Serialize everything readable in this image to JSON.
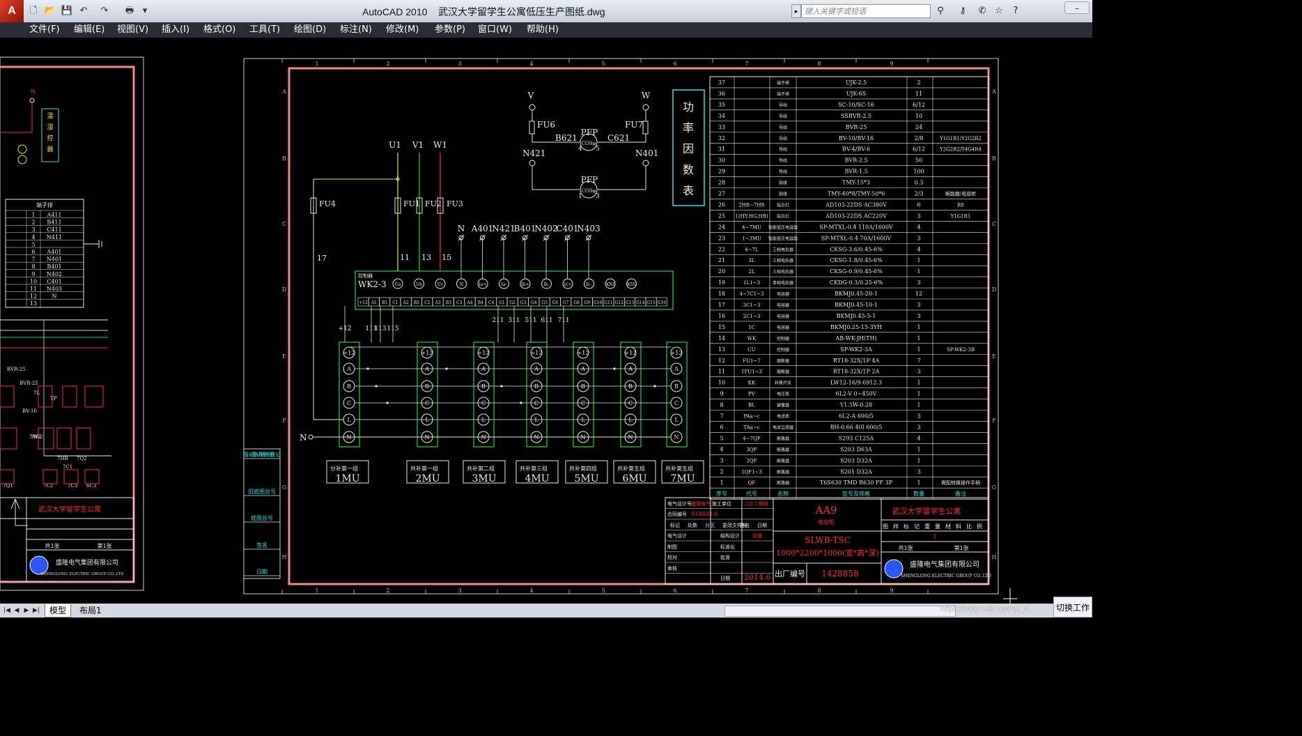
{
  "app": {
    "logo": "A",
    "title": "AutoCAD 2010",
    "file": "武汉大学留学生公寓低压生产图纸.dwg"
  },
  "quick_access": [
    {
      "name": "new-icon",
      "glyph": "🗋"
    },
    {
      "name": "open-icon",
      "glyph": "📂"
    },
    {
      "name": "save-icon",
      "glyph": "💾"
    },
    {
      "name": "undo-icon",
      "glyph": "↶"
    },
    {
      "name": "redo-icon",
      "glyph": "↷"
    },
    {
      "name": "plot-icon",
      "glyph": "🖶"
    },
    {
      "name": "dropdown-icon",
      "glyph": "▾"
    }
  ],
  "search": {
    "placeholder": "键入关键字或短语"
  },
  "title_icons": [
    {
      "name": "infocenter-icon",
      "glyph": "⚲"
    },
    {
      "name": "subscription-icon",
      "glyph": "⚷"
    },
    {
      "name": "communication-icon",
      "glyph": "✆"
    },
    {
      "name": "favorites-icon",
      "glyph": "☆"
    },
    {
      "name": "help-icon",
      "glyph": "?"
    }
  ],
  "window_controls": {
    "minimize": "–"
  },
  "menu": [
    "文件(F)",
    "编辑(E)",
    "视图(V)",
    "插入(I)",
    "格式(O)",
    "工具(T)",
    "绘图(D)",
    "标注(N)",
    "修改(M)",
    "参数(P)",
    "窗口(W)",
    "帮助(H)"
  ],
  "status": {
    "tabs": [
      "模型",
      "布局1"
    ],
    "active_tab": 0,
    "switch": "切换工作",
    "watermark": "https://blog.csdn.net/qq_4..."
  },
  "colors": {
    "frame": "#f08a8a",
    "green": "#1fd81f",
    "cyan": "#2fe0e0",
    "yellow": "#f0e040",
    "red": "#ff2a2a",
    "white": "#e8e8e8"
  },
  "drawing": {
    "grid_cols": [
      "1",
      "2",
      "3",
      "4",
      "5",
      "6",
      "7",
      "8",
      "9"
    ],
    "grid_rows": [
      "A",
      "B",
      "C",
      "D",
      "E",
      "F",
      "G",
      "H"
    ],
    "pfp1": {
      "v": "V",
      "w": "W",
      "fu6": "FU6",
      "fu7": "FU7",
      "b621": "B621",
      "c621": "C621",
      "label": "PFP",
      "cos": "COSφ",
      "n421": "N421",
      "n401": "N401",
      "p4": "4",
      "p5": "5"
    },
    "pfp2": {
      "label": "PFP",
      "cos": "COSφ",
      "p1": "1",
      "p3": "3"
    },
    "pf_title": [
      "功",
      "率",
      "因",
      "数",
      "表"
    ],
    "phase": {
      "u1": "U1",
      "v1": "V1",
      "w1": "W1",
      "fu1": "FU1",
      "fu2": "FU2",
      "fu3": "FU3",
      "fu4": "FU4",
      "n11": "11",
      "n13": "13",
      "n15": "15",
      "n17": "17"
    },
    "wk": {
      "header": "控制器",
      "name": "WK2-3",
      "top_terms": [
        "Ua",
        "Ub",
        "Uc",
        "N",
        "Ia+",
        "Ia-",
        "Ib+",
        "Ib-",
        "Ic+",
        "Ic-",
        "KNI",
        "KNI"
      ],
      "top_labels": [
        "N",
        "A401",
        "N421",
        "B401",
        "N402",
        "C401",
        "N403"
      ],
      "bottom_terms": [
        "+12",
        "A1",
        "B1",
        "C1",
        "A2",
        "B2",
        "C2",
        "A3",
        "B3",
        "C3",
        "A4",
        "B4",
        "C4",
        "G1",
        "G2",
        "G3",
        "G4",
        "G5",
        "G6",
        "G7",
        "G8",
        "G9",
        "G10",
        "G11",
        "G12",
        "G13",
        "G14",
        "G15",
        "G16"
      ],
      "wire_labels": [
        "+12",
        "111",
        "113",
        "115",
        "211",
        "311",
        "511",
        "611",
        "711"
      ]
    },
    "mods": [
      {
        "title": "分补第一组",
        "name": "1MU"
      },
      {
        "title": "共补第一组",
        "name": "2MU"
      },
      {
        "title": "共补第二组",
        "name": "3MU"
      },
      {
        "title": "共补第三组",
        "name": "4MU"
      },
      {
        "title": "共补第四组",
        "name": "5MU"
      },
      {
        "title": "共补第五组",
        "name": "6MU"
      },
      {
        "title": "共补第五组",
        "name": "7MU"
      }
    ],
    "mod_terms": [
      "+12",
      "A",
      "B",
      "C",
      "L",
      "N"
    ],
    "n_label": "N",
    "bom": {
      "headers": [
        "序号",
        "代号",
        "名称",
        "型号及规格",
        "数量",
        "备注"
      ],
      "rows": [
        [
          "37",
          "",
          "端子排",
          "UJK-2.5",
          "2",
          ""
        ],
        [
          "36",
          "",
          "端子排",
          "UJK-6S",
          "11",
          ""
        ],
        [
          "35",
          "",
          "导线",
          "SC-10/SC-16",
          "6/12",
          ""
        ],
        [
          "34",
          "",
          "导线",
          "SSBVR-2.5",
          "10",
          ""
        ],
        [
          "33",
          "",
          "导线",
          "BVR-25",
          "24",
          ""
        ],
        [
          "32",
          "",
          "导线",
          "BV-10/BV-16",
          "2/8",
          "Y1G1R1/Y2G2R2"
        ],
        [
          "31",
          "",
          "导线",
          "BV-4/BV-6",
          "6/12",
          "Y2G2R2/Y4G4R4"
        ],
        [
          "30",
          "",
          "导线",
          "BVR-2.5",
          "50",
          ""
        ],
        [
          "29",
          "",
          "导线",
          "BVR-1.5",
          "100",
          ""
        ],
        [
          "28",
          "",
          "铜排",
          "TMY-15*3",
          "0.3",
          ""
        ],
        [
          "27",
          "",
          "铜排",
          "TMY-40*8/TMY-50*6",
          "2/3",
          "断路器/电容柜"
        ],
        [
          "26",
          "2HR~7HR",
          "指示灯",
          "AD103-22DS AC380V",
          "6",
          "R8"
        ],
        [
          "25",
          "1(HY,HG,HR)",
          "指示灯",
          "AD103-22DS AC220V",
          "3",
          "Y1G1R1"
        ],
        [
          "24",
          "4~7MU",
          "智能低压电容器",
          "SP-MTXL-0.4 110A/1600V",
          "4",
          ""
        ],
        [
          "23",
          "1~3MU",
          "智能低压电容器",
          "SP-MTXL-0.4 70A/1600V",
          "3",
          ""
        ],
        [
          "22",
          "4~7L",
          "三相电抗器",
          "CKSG-3.6/0.45-6%",
          "4",
          ""
        ],
        [
          "21",
          "3L",
          "三相电抗器",
          "CKSG-1.8/0.45-6%",
          "1",
          ""
        ],
        [
          "20",
          "2L",
          "三相电抗器",
          "CKSG-0.9/0.45-6%",
          "1",
          ""
        ],
        [
          "19",
          "1L1~3",
          "单相电抗器",
          "CKDG-0.3/0.25-6%",
          "3",
          ""
        ],
        [
          "18",
          "4~7C1~3",
          "电容器",
          "BKMJ0.45-20-1",
          "12",
          ""
        ],
        [
          "17",
          "3C1~3",
          "电容器",
          "BKMJ0.45-10-1",
          "3",
          ""
        ],
        [
          "16",
          "2C1~3",
          "电容器",
          "BKMJ0.45-5-1",
          "3",
          ""
        ],
        [
          "15",
          "1C",
          "电容器",
          "BKMJ0.25-15-3YH",
          "1",
          ""
        ],
        [
          "14",
          "WK",
          "控制器",
          "AB-WK-JH(TH)",
          "1",
          ""
        ],
        [
          "13",
          "CU",
          "控制器",
          "SP-WK2-3A",
          "1",
          "SP-WK2-3B"
        ],
        [
          "12",
          "FU1~7",
          "熔断器",
          "RT18-32X/1P 4A",
          "7",
          ""
        ],
        [
          "11",
          "1FU1~3",
          "熔断器",
          "RT18-32X/1P 2A",
          "3",
          ""
        ],
        [
          "10",
          "KK",
          "转换开关",
          "LW12-16/9.6912.3",
          "1",
          ""
        ],
        [
          "9",
          "PV",
          "电压表",
          "6L2-V 0~450V",
          "1",
          ""
        ],
        [
          "8",
          "BL",
          "避雷器",
          "Y1.5W-0.28",
          "1",
          ""
        ],
        [
          "7",
          "PAa~c",
          "电流表",
          "6L2-A 600/5",
          "3",
          ""
        ],
        [
          "6",
          "TAa~c",
          "电流互感器",
          "BH-0.66 40I 600/5",
          "3",
          ""
        ],
        [
          "5",
          "4~7QF",
          "断路器",
          "S293 C125A",
          "4",
          ""
        ],
        [
          "4",
          "3QF",
          "断路器",
          "S203 D63A",
          "1",
          ""
        ],
        [
          "3",
          "2QF",
          "断路器",
          "S203 D32A",
          "1",
          ""
        ],
        [
          "2",
          "1QF1~3",
          "断路器",
          "S201 D32A",
          "3",
          ""
        ],
        [
          "1",
          "QF",
          "断路器",
          "T6S630 TMD R630 FF 3P",
          "1",
          "需配转换操作手柄"
        ]
      ]
    },
    "title_block": {
      "project": "武汉大学留学生公寓",
      "aa9": "AA9",
      "cabinet": "电容柜",
      "model": "SLWB-TSC",
      "dims": "1000*2200*1000(宽*高*深)",
      "factory_label": "出厂编号",
      "factory_no": "1428858",
      "date": "2014.6",
      "company_cn": "盛隆电气集团有限公司",
      "company_en": "SHENGLONG ELECTRIC GROUP CO.,LTD",
      "sheet_total": "共1张",
      "sheet_no": "第1张",
      "r1a": "电气设计号",
      "r1b": "施工单位",
      "r1c": "盛隆电气",
      "r1d": "二区二期组",
      "r2a": "合同编号",
      "r2b": "S14608.6",
      "r3": [
        "标记",
        "处数",
        "分区",
        "更改文件号",
        "签名",
        "日期"
      ],
      "r4a": "电气设计",
      "r4b": "结构设计",
      "r4c": "张强",
      "r5a": "制图",
      "r5b": "标准化",
      "r6a": "校对",
      "r6b": "批准",
      "r7a": "审核",
      "r7b": "日期",
      "col_head": [
        "图样标记",
        "重量",
        "比例"
      ],
      "col_head2": [
        "图",
        "样",
        "标",
        "记",
        "重",
        "量",
        "材",
        "料",
        "比",
        "例"
      ],
      "qty": "1"
    },
    "left_strip": [
      "借(通)用件登记",
      "旧底图总号",
      "底图总号",
      "签名",
      "日期"
    ],
    "left_strip_top": "CAD制图",
    "left_sheet": {
      "term_title": "端子排",
      "terms": [
        [
          "1",
          "A411"
        ],
        [
          "2",
          "B411"
        ],
        [
          "3",
          "C411"
        ],
        [
          "4",
          "N411"
        ],
        [
          "5",
          ""
        ],
        [
          "6",
          "A401"
        ],
        [
          "7",
          "N401"
        ],
        [
          "8",
          "B401"
        ],
        [
          "9",
          "N402"
        ],
        [
          "10",
          "C401"
        ],
        [
          "11",
          "N403"
        ],
        [
          "12",
          "N"
        ],
        [
          "13",
          ""
        ]
      ],
      "vert_label": [
        "温",
        "湿",
        "控",
        "器"
      ],
      "n": "N",
      "project": "武汉大学留学生公寓",
      "labels": [
        "BVR-25",
        "BVR-25",
        "BV-16",
        "7MU",
        "7L",
        "7HR",
        "7C1",
        "7C2",
        "7C3",
        "6C3",
        "7Q1",
        "7Q2",
        "TP",
        "7MU"
      ],
      "sheet_total": "共1张",
      "sheet_no": "第1张",
      "company_cn": "盛隆电气集团有限公司",
      "company_en": "SHENGLONG ELECTRIC GROUP CO.,LTD"
    }
  }
}
